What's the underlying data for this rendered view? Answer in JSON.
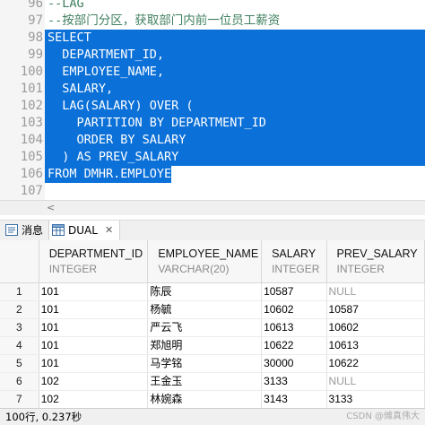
{
  "editor": {
    "lines": [
      {
        "num": "96",
        "text": "--LAG"
      },
      {
        "num": "97",
        "text": "--按部门分区，获取部门内前一位员工薪资"
      },
      {
        "num": "98",
        "text": "SELECT"
      },
      {
        "num": "99",
        "text": "  DEPARTMENT_ID,"
      },
      {
        "num": "100",
        "text": "  EMPLOYEE_NAME,"
      },
      {
        "num": "101",
        "text": "  SALARY,"
      },
      {
        "num": "102",
        "text": "  LAG(SALARY) OVER ("
      },
      {
        "num": "103",
        "text": "    PARTITION BY DEPARTMENT_ID"
      },
      {
        "num": "104",
        "text": "    ORDER BY SALARY"
      },
      {
        "num": "105",
        "text": "  ) AS PREV_SALARY"
      },
      {
        "num": "106",
        "text": "FROM DMHR.EMPLOYEE;"
      },
      {
        "num": "107",
        "text": ""
      }
    ],
    "scroll_arrow": "<"
  },
  "tabs": {
    "messages": "消息",
    "dual": "DUAL",
    "close": "✕"
  },
  "grid": {
    "columns": [
      {
        "name": "DEPARTMENT_ID",
        "type": "INTEGER"
      },
      {
        "name": "EMPLOYEE_NAME",
        "type": "VARCHAR(20)"
      },
      {
        "name": "SALARY",
        "type": "INTEGER"
      },
      {
        "name": "PREV_SALARY",
        "type": "INTEGER"
      }
    ],
    "rows": [
      {
        "n": "1",
        "cells": [
          "101",
          "陈辰",
          "10587",
          "NULL"
        ]
      },
      {
        "n": "2",
        "cells": [
          "101",
          "杨毓",
          "10602",
          "10587"
        ]
      },
      {
        "n": "3",
        "cells": [
          "101",
          "严云飞",
          "10613",
          "10602"
        ]
      },
      {
        "n": "4",
        "cells": [
          "101",
          "郑旭明",
          "10622",
          "10613"
        ]
      },
      {
        "n": "5",
        "cells": [
          "101",
          "马学铭",
          "30000",
          "10622"
        ]
      },
      {
        "n": "6",
        "cells": [
          "102",
          "王金玉",
          "3133",
          "NULL"
        ]
      },
      {
        "n": "7",
        "cells": [
          "102",
          "林婉森",
          "3143",
          "3133"
        ]
      }
    ]
  },
  "status": {
    "summary": "100行, 0.237秒",
    "watermark": "CSDN @傩真伟大"
  },
  "colors": {
    "selection": "#0b70d8",
    "comment": "#3f7f5f",
    "null": "#9a9a9a"
  }
}
